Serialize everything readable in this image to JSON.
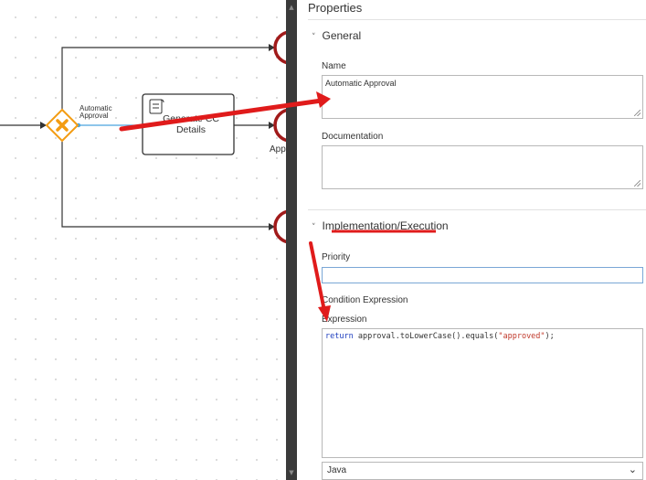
{
  "diagram": {
    "gateway_label": "Automatic\nApproval",
    "task_label": "Generate CC\nDetails",
    "partial_label": "App"
  },
  "properties": {
    "title": "Properties",
    "general_section": "General",
    "name_label": "Name",
    "name_value": "Automatic Approval",
    "documentation_label": "Documentation",
    "documentation_value": "",
    "impl_section": "Implementation/Execution",
    "priority_label": "Priority",
    "priority_value": "",
    "condition_label": "Condition Expression",
    "expression_label": "Expression",
    "expression_keyword": "return",
    "expression_body": " approval.toLowerCase().equals(",
    "expression_string": "\"approved\"",
    "expression_end": ");",
    "language_value": "Java"
  },
  "colors": {
    "gateway": "#f39c12",
    "end_event": "#a11a1a",
    "annotation": "#e01b1b",
    "selection": "#4aa3df",
    "keyword": "#1f3fbf"
  }
}
